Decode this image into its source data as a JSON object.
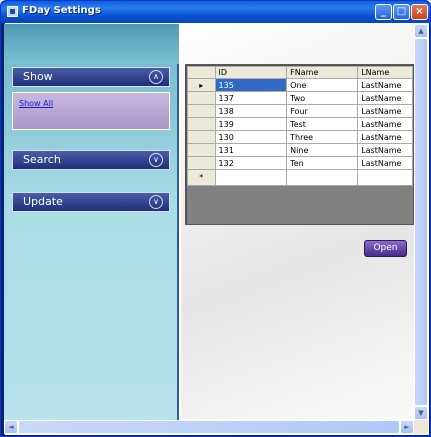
{
  "window": {
    "title": "FDay Settings",
    "buttons": {
      "minimize": "_",
      "maximize": "□",
      "close": "×"
    }
  },
  "sidebar": {
    "panels": [
      {
        "label": "Show",
        "chevron": "∧",
        "expanded": true
      },
      {
        "label": "Search",
        "chevron": "∨",
        "expanded": false
      },
      {
        "label": "Update",
        "chevron": "∨",
        "expanded": false
      }
    ],
    "show_link": "Show All"
  },
  "grid": {
    "columns": [
      "ID",
      "FName",
      "LName"
    ],
    "rows": [
      {
        "indicator": "▸",
        "id": "135",
        "fname": "One",
        "lname": "LastName"
      },
      {
        "indicator": "",
        "id": "137",
        "fname": "Two",
        "lname": "LastName"
      },
      {
        "indicator": "",
        "id": "138",
        "fname": "Four",
        "lname": "LastName"
      },
      {
        "indicator": "",
        "id": "139",
        "fname": "Test",
        "lname": "LastName"
      },
      {
        "indicator": "",
        "id": "130",
        "fname": "Three",
        "lname": "LastName"
      },
      {
        "indicator": "",
        "id": "131",
        "fname": "Nine",
        "lname": "LastName"
      },
      {
        "indicator": "",
        "id": "132",
        "fname": "Ten",
        "lname": "LastName"
      }
    ],
    "new_row_indicator": "*"
  },
  "main": {
    "open_button": "Open"
  },
  "scroll": {
    "up": "▲",
    "down": "▼",
    "left": "◄",
    "right": "►"
  }
}
